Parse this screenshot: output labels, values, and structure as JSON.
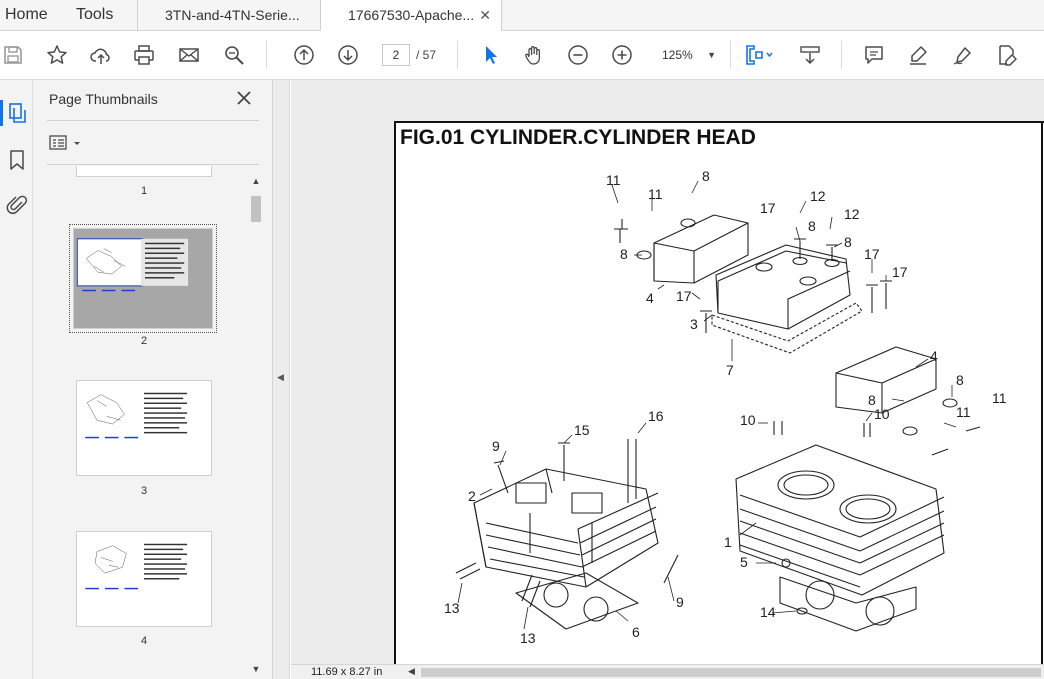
{
  "menu": {
    "home": "Home",
    "tools": "Tools"
  },
  "tabs": [
    {
      "title": "3TN-and-4TN-Serie...",
      "active": false
    },
    {
      "title": "17667530-Apache...",
      "active": true,
      "close": "✕"
    }
  ],
  "toolbar": {
    "icons": [
      "save-icon",
      "bookmark-star-icon",
      "cloud-upload-icon",
      "print-icon",
      "email-icon",
      "search-zoom-icon",
      "prev-page-icon",
      "next-page-icon",
      "select-cursor-icon",
      "hand-tool-icon",
      "zoom-out-icon",
      "zoom-in-icon",
      "fit-page-icon",
      "scroll-mode-icon",
      "comment-icon",
      "highlight-icon",
      "sign-icon",
      "edit-pdf-icon"
    ],
    "current_page": "2",
    "total_pages": "/ 57",
    "zoom": "125%"
  },
  "rail": {
    "icons": [
      "page-thumbnails-icon",
      "bookmarks-icon",
      "attachments-icon"
    ]
  },
  "thumbnails_panel": {
    "title": "Page Thumbnails",
    "pages": [
      {
        "number": "1"
      },
      {
        "number": "2",
        "selected": true
      },
      {
        "number": "3"
      },
      {
        "number": "4"
      }
    ]
  },
  "document": {
    "title": "FIG.01 CYLINDER.CYLINDER HEAD",
    "callouts": [
      "11",
      "11",
      "8",
      "12",
      "17",
      "8",
      "12",
      "8",
      "8",
      "17",
      "17",
      "17",
      "4",
      "3",
      "4",
      "7",
      "8",
      "8",
      "11",
      "11",
      "9",
      "15",
      "16",
      "10",
      "10",
      "2",
      "1",
      "5",
      "13",
      "13",
      "9",
      "6",
      "14"
    ]
  },
  "statusbar": {
    "page_size": "11.69 x 8.27 in"
  },
  "colors": {
    "accent": "#1473e6",
    "toolbar_icon": "#4b4b4b",
    "thumb_link": "#1a3fd1"
  }
}
